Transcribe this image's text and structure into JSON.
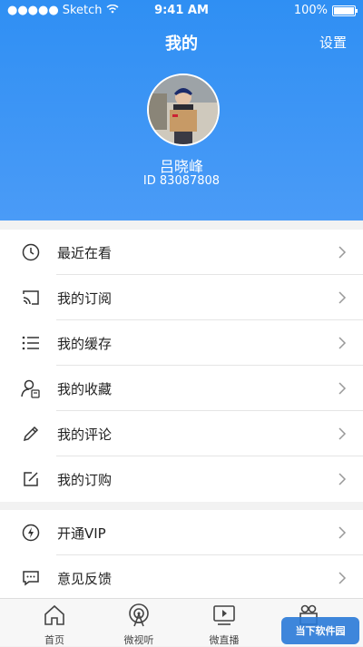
{
  "status_bar": {
    "carrier": "Sketch",
    "time": "9:41 AM",
    "battery": "100%"
  },
  "nav": {
    "title": "我的",
    "settings": "设置"
  },
  "profile": {
    "name": "吕晓峰",
    "id_text": "ID 83087808"
  },
  "menu_group1": [
    {
      "label": "最近在看",
      "icon": "clock-icon"
    },
    {
      "label": "我的订阅",
      "icon": "cast-icon"
    },
    {
      "label": "我的缓存",
      "icon": "list-icon"
    },
    {
      "label": "我的收藏",
      "icon": "user-favorite-icon"
    },
    {
      "label": "我的评论",
      "icon": "pencil-icon"
    },
    {
      "label": "我的订购",
      "icon": "edit-icon"
    }
  ],
  "menu_group2": [
    {
      "label": "开通VIP",
      "icon": "lightning-icon"
    },
    {
      "label": "意见反馈",
      "icon": "chat-icon"
    }
  ],
  "tabs": [
    {
      "label": "首页",
      "icon": "home-icon"
    },
    {
      "label": "微视听",
      "icon": "broadcast-icon"
    },
    {
      "label": "微直播",
      "icon": "tv-icon"
    },
    {
      "label": "",
      "icon": "gift-icon"
    }
  ],
  "watermark": "当下软件园",
  "colors": {
    "header_top": "#2f8ff3",
    "header_bottom": "#4a9bf7"
  }
}
